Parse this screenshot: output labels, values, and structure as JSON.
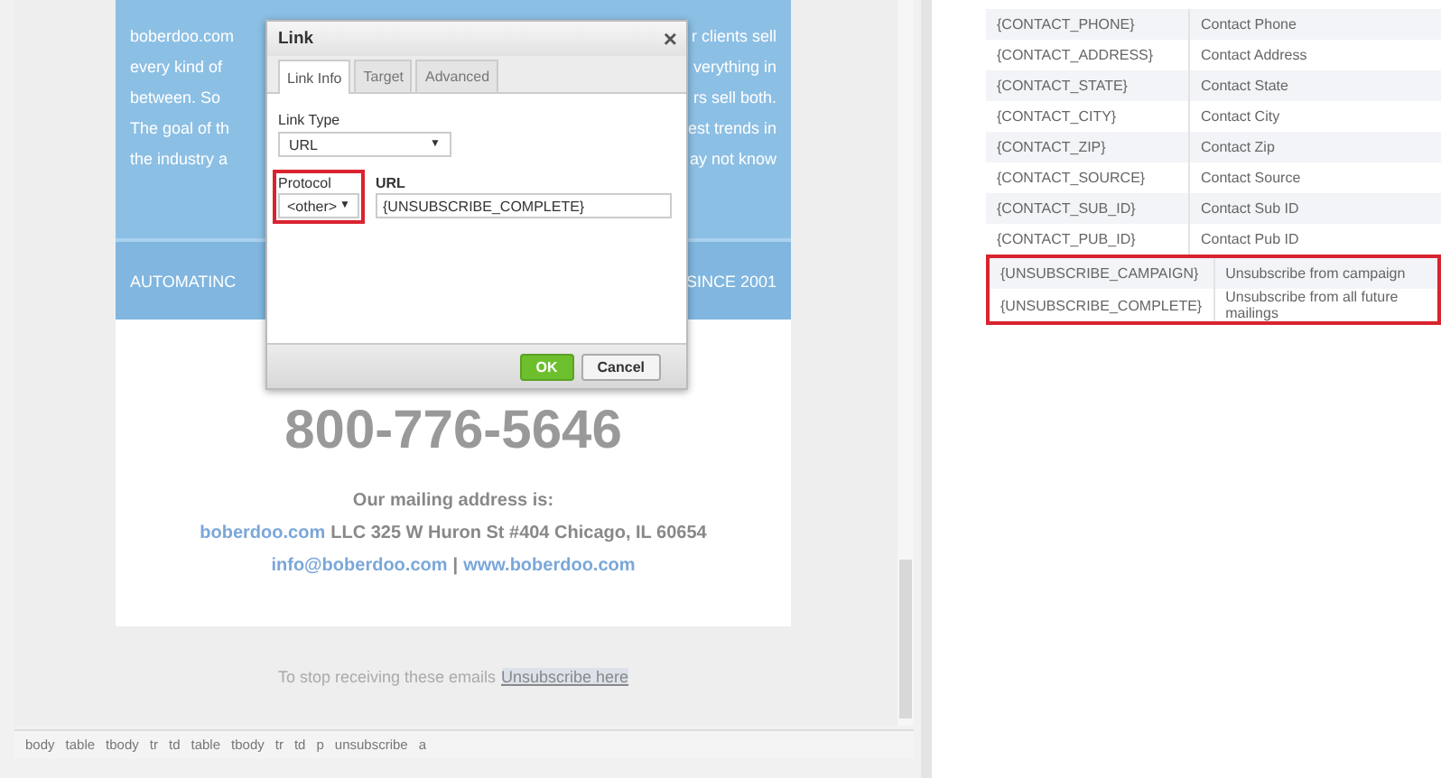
{
  "email": {
    "intro_lines": [
      {
        "left": "boberdoo.com",
        "right": "r clients sell"
      },
      {
        "left": "every kind of",
        "right": "verything in"
      },
      {
        "left": "between. So",
        "right": "rs sell both."
      },
      {
        "left": "The goal of th",
        "right": "est trends in"
      },
      {
        "left": "the industry a",
        "right": "ay not know"
      }
    ],
    "banner": {
      "left": "AUTOMATINC",
      "right": "SINCE 2001"
    },
    "phone": "800-776-5646",
    "mailing_heading": "Our mailing address is:",
    "address_link": "boberdoo.com",
    "address_rest": "LLC 325 W Huron St #404 Chicago, IL 60654",
    "email_link": "info@boberdoo.com",
    "separator": "|",
    "site_link": "www.boberdoo.com",
    "footer_text": "To stop receiving these emails",
    "unsubscribe_link": "Unsubscribe here"
  },
  "element_path": [
    "body",
    "table",
    "tbody",
    "tr",
    "td",
    "table",
    "tbody",
    "tr",
    "td",
    "p",
    "unsubscribe",
    "a"
  ],
  "dialog": {
    "title": "Link",
    "close": "×",
    "tabs": [
      {
        "label": "Link Info",
        "selected": true
      },
      {
        "label": "Target",
        "selected": false
      },
      {
        "label": "Advanced",
        "selected": false
      }
    ],
    "link_type": {
      "label": "Link Type",
      "value": "URL",
      "caret": "▼"
    },
    "protocol": {
      "label": "Protocol",
      "value": "<other>",
      "caret": "▼",
      "highlighted": true
    },
    "url": {
      "label": "URL",
      "value": "{UNSUBSCRIBE_COMPLETE}"
    },
    "buttons": [
      {
        "label": "OK",
        "kind": "primary"
      },
      {
        "label": "Cancel",
        "kind": "secondary"
      }
    ]
  },
  "merge_fields": {
    "rows": [
      {
        "tag": "{CONTACT_PHONE}",
        "description": "Contact Phone",
        "highlighted": false
      },
      {
        "tag": "{CONTACT_ADDRESS}",
        "description": "Contact Address",
        "highlighted": false
      },
      {
        "tag": "{CONTACT_STATE}",
        "description": "Contact State",
        "highlighted": false
      },
      {
        "tag": "{CONTACT_CITY}",
        "description": "Contact City",
        "highlighted": false
      },
      {
        "tag": "{CONTACT_ZIP}",
        "description": "Contact Zip",
        "highlighted": false
      },
      {
        "tag": "{CONTACT_SOURCE}",
        "description": "Contact Source",
        "highlighted": false
      },
      {
        "tag": "{CONTACT_SUB_ID}",
        "description": "Contact Sub ID",
        "highlighted": false
      },
      {
        "tag": "{CONTACT_PUB_ID}",
        "description": "Contact Pub ID",
        "highlighted": false
      },
      {
        "tag": "{UNSUBSCRIBE_CAMPAIGN}",
        "description": "Unsubscribe from campaign",
        "highlighted": true
      },
      {
        "tag": "{UNSUBSCRIBE_COMPLETE}",
        "description": "Unsubscribe from all future mailings",
        "highlighted": true
      }
    ]
  }
}
